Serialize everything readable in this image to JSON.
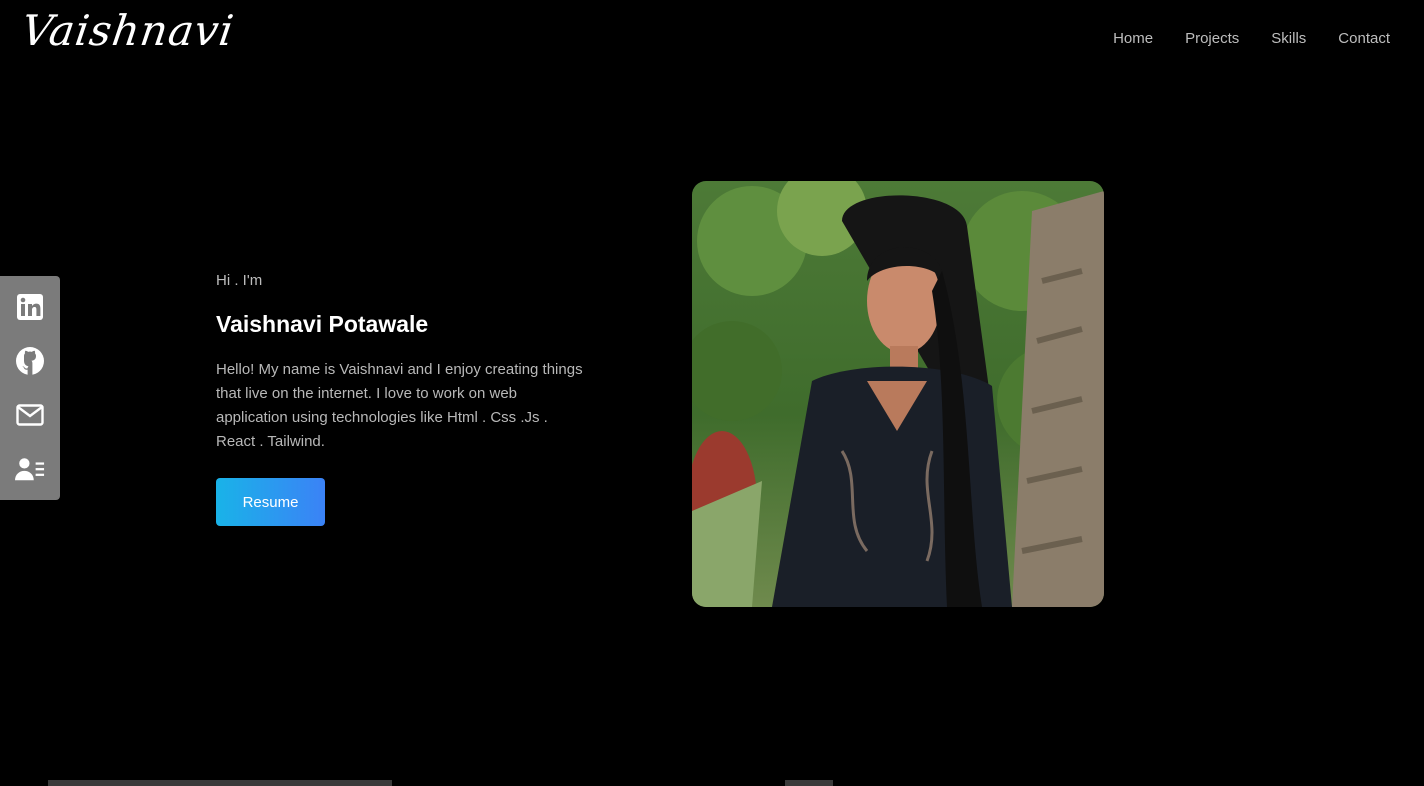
{
  "brand": {
    "logo": "Vaishnavi"
  },
  "nav": [
    "Home",
    "Projects",
    "Skills",
    "Contact"
  ],
  "social": [
    {
      "icon": "linkedin-icon"
    },
    {
      "icon": "github-icon"
    },
    {
      "icon": "mail-icon"
    },
    {
      "icon": "contact-card-icon"
    }
  ],
  "hero": {
    "greeting": "Hi . I'm",
    "name": "Vaishnavi Potawale",
    "bio": "Hello! My name is Vaishnavi and I enjoy creating things that live on the internet. I love to work on web application using technologies like Html . Css .Js . React . Tailwind.",
    "resume_label": "Resume"
  },
  "colors": {
    "background": "#000000",
    "sidebar": "#7b7b7b",
    "button_start": "#19b3e8",
    "button_end": "#3b82f6"
  }
}
